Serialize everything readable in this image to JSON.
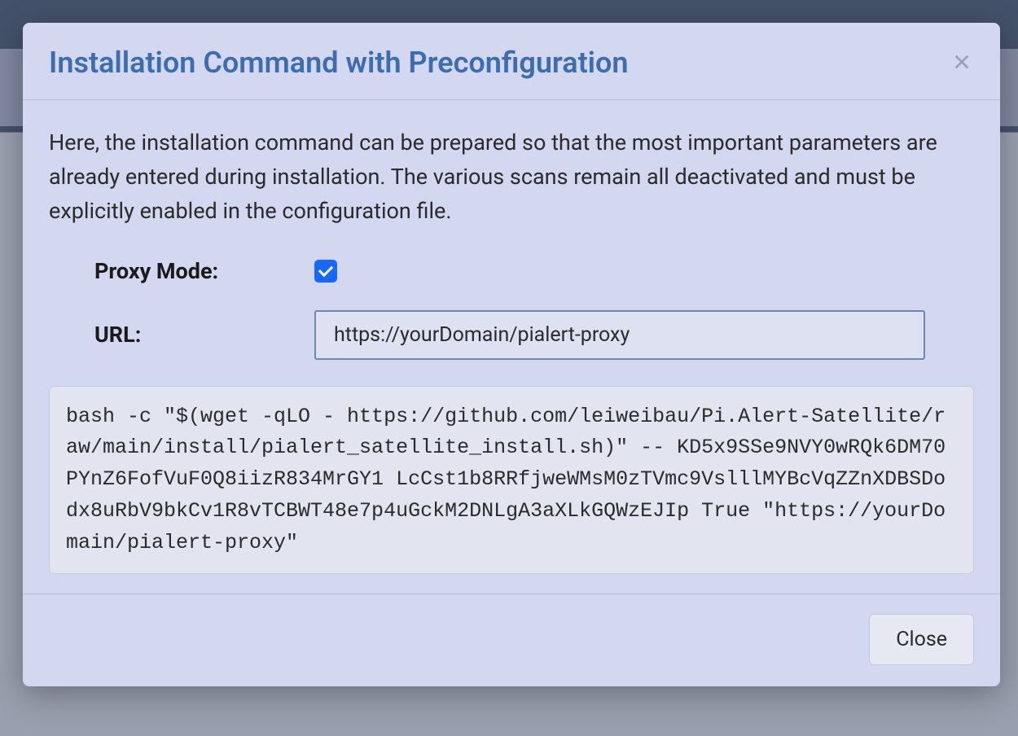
{
  "modal": {
    "title": "Installation Command with Preconfiguration",
    "description": "Here, the installation command can be prepared so that the most important parameters are already entered during installation. The various scans remain all deactivated and must be explicitly enabled in the configuration file.",
    "proxy_mode_label": "Proxy Mode:",
    "proxy_mode_checked": true,
    "url_label": "URL:",
    "url_value": "https://yourDomain/pialert-proxy",
    "command": "bash -c \"$(wget -qLO - https://github.com/leiweibau/Pi.Alert-Satellite/raw/main/install/pialert_satellite_install.sh)\" -- KD5x9SSe9NVY0wRQk6DM70PYnZ6FofVuF0Q8iizR834MrGY1 LcCst1b8RRfjweWMsM0zTVmc9VslllMYBcVqZZnXDBSDodx8uRbV9bkCv1R8vTCBWT48e7p4uGckM2DNLgA3aXLkGQWzEJIp True \"https://yourDomain/pialert-proxy\"",
    "close_label": "Close"
  }
}
